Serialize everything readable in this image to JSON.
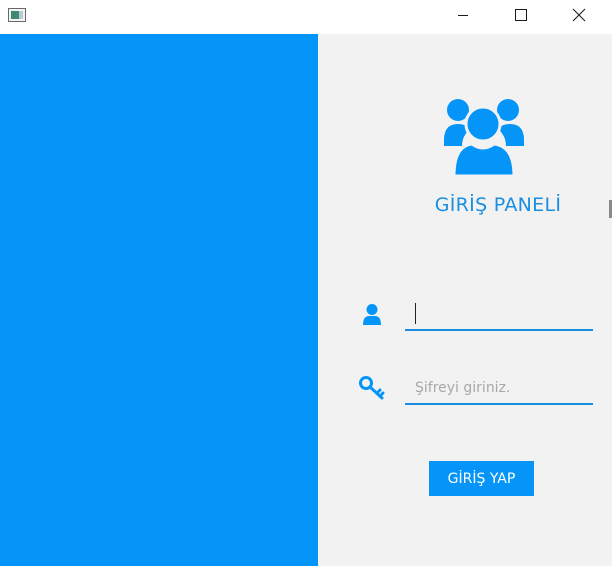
{
  "window": {
    "icon": "app-window-icon",
    "controls": {
      "minimize_icon": "minimize-icon",
      "maximize_icon": "maximize-icon",
      "close_icon": "close-icon"
    }
  },
  "colors": {
    "accent": "#0595f8",
    "title": "#1a8ee0",
    "right_background": "#f2f2f2"
  },
  "login": {
    "header_icon": "users-group-icon",
    "title": "GİRİŞ PANELİ",
    "username": {
      "icon": "user-icon",
      "value": "",
      "placeholder": ""
    },
    "password": {
      "icon": "key-icon",
      "value": "",
      "placeholder": "Şifreyi giriniz."
    },
    "submit_label": "GİRİŞ YAP"
  }
}
